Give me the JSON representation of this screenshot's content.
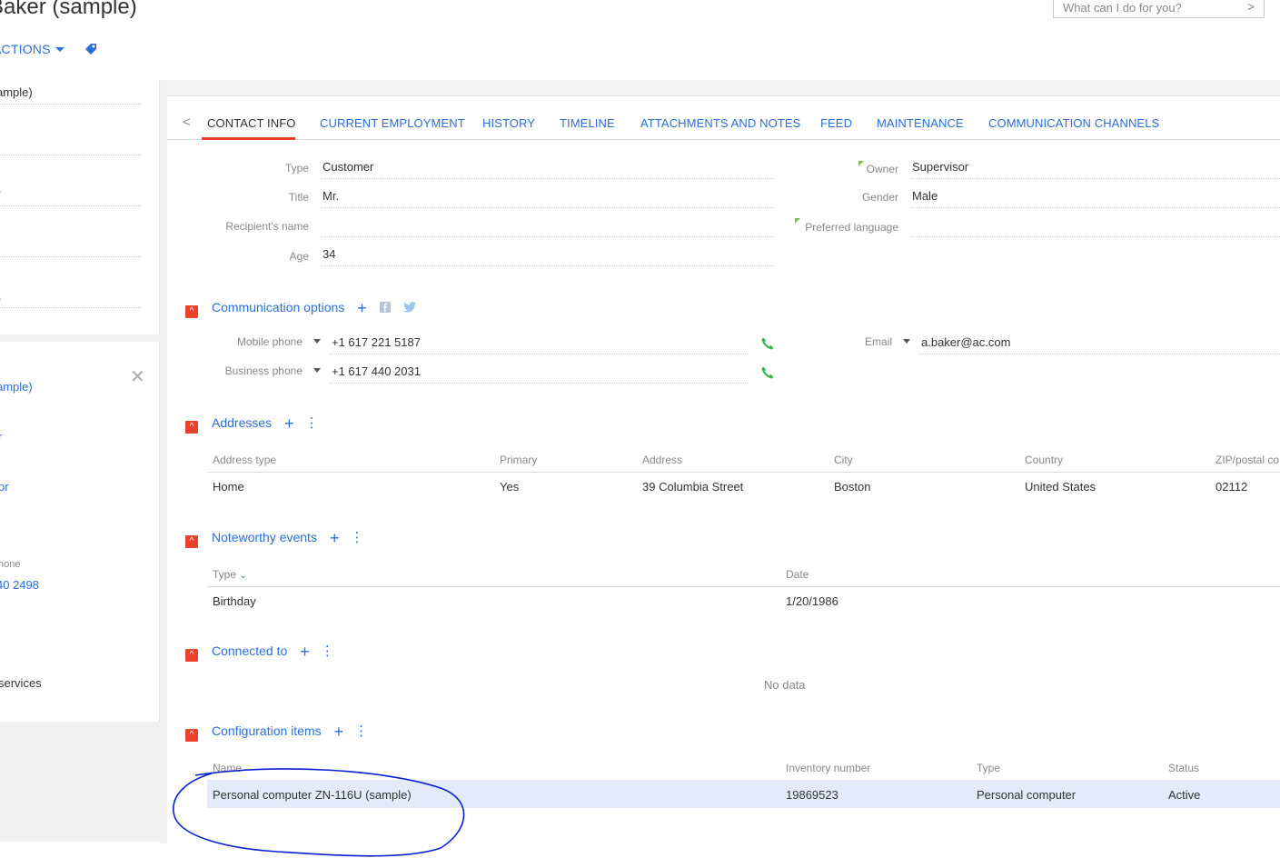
{
  "header": {
    "title": "Baker (sample)",
    "actions_label": "ACTIONS",
    "tag_icon": "tag-icon",
    "search_placeholder": "What can I do for you?"
  },
  "left_panel": {
    "top_items": [
      "ample)"
    ],
    "bottom_items": [
      {
        "text": "ample)",
        "color": "#2c6fd6"
      },
      {
        "text": "r",
        "color": "#2c6fd6"
      },
      {
        "text": "or",
        "color": "#2c6fd6"
      },
      {
        "text": "hone",
        "color": "#888888"
      },
      {
        "text": "40 2498",
        "color": "#2c6fd6"
      },
      {
        "text": "services",
        "color": "#333333"
      }
    ]
  },
  "tabs": [
    {
      "label": "CONTACT INFO",
      "active": true
    },
    {
      "label": "CURRENT EMPLOYMENT"
    },
    {
      "label": "HISTORY"
    },
    {
      "label": "TIMELINE"
    },
    {
      "label": "ATTACHMENTS AND NOTES"
    },
    {
      "label": "FEED"
    },
    {
      "label": "MAINTENANCE"
    },
    {
      "label": "COMMUNICATION CHANNELS"
    }
  ],
  "contact_fields": {
    "type_label": "Type",
    "type_value": "Customer",
    "title_label": "Title",
    "title_value": "Mr.",
    "recipient_label": "Recipient's name",
    "recipient_value": "",
    "age_label": "Age",
    "age_value": "34",
    "owner_label": "Owner",
    "owner_value": "Supervisor",
    "gender_label": "Gender",
    "gender_value": "Male",
    "language_label": "Preferred language",
    "language_value": ""
  },
  "communication": {
    "title": "Communication options",
    "mobile_label": "Mobile phone",
    "mobile_value": "+1 617 221 5187",
    "business_label": "Business phone",
    "business_value": "+1 617 440 2031",
    "email_label": "Email",
    "email_value": "a.baker@ac.com"
  },
  "addresses": {
    "title": "Addresses",
    "columns": [
      "Address type",
      "Primary",
      "Address",
      "City",
      "Country",
      "ZIP/postal co"
    ],
    "rows": [
      [
        "Home",
        "Yes",
        "39 Columbia Street",
        "Boston",
        "United States",
        "02112"
      ]
    ]
  },
  "events": {
    "title": "Noteworthy events",
    "columns": [
      "Type",
      "Date"
    ],
    "rows": [
      [
        "Birthday",
        "1/20/1986"
      ]
    ]
  },
  "connected": {
    "title": "Connected to",
    "empty": "No data"
  },
  "config": {
    "title": "Configuration items",
    "columns": [
      "Name",
      "Inventory number",
      "Type",
      "Status"
    ],
    "rows": [
      [
        "Personal computer ZN-116U (sample)",
        "19869523",
        "Personal computer",
        "Active"
      ]
    ]
  },
  "colors": {
    "accent": "#2c6fd6",
    "tab_underline": "#e8412c",
    "section_toggle": "#e8412c",
    "row_highlight": "#e3ebfa",
    "annotation": "#0a1fd0",
    "phone_icon": "#39b54a"
  }
}
